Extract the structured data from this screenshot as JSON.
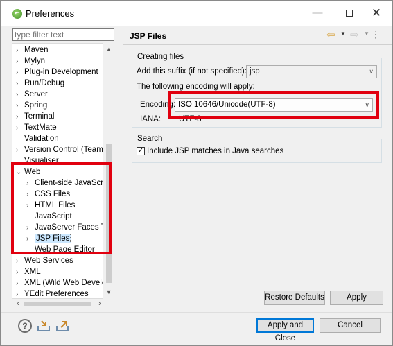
{
  "window": {
    "title": "Preferences",
    "minimize_glyph": "—",
    "close_glyph": "✕"
  },
  "filter": {
    "placeholder": "type filter text"
  },
  "tree": {
    "items": [
      {
        "label": "Maven",
        "arrow": "›"
      },
      {
        "label": "Mylyn",
        "arrow": "›"
      },
      {
        "label": "Plug-in Development",
        "arrow": "›"
      },
      {
        "label": "Run/Debug",
        "arrow": "›"
      },
      {
        "label": "Server",
        "arrow": "›"
      },
      {
        "label": "Spring",
        "arrow": "›"
      },
      {
        "label": "Terminal",
        "arrow": "›"
      },
      {
        "label": "TextMate",
        "arrow": "›"
      },
      {
        "label": "Validation",
        "arrow": ""
      },
      {
        "label": "Version Control (Team)",
        "arrow": "›"
      },
      {
        "label": "Visualiser",
        "arrow": ""
      },
      {
        "label": "Web",
        "arrow": "⌄"
      },
      {
        "label": "Client-side JavaScript",
        "arrow": "›"
      },
      {
        "label": "CSS Files",
        "arrow": "›"
      },
      {
        "label": "HTML Files",
        "arrow": "›"
      },
      {
        "label": "JavaScript",
        "arrow": ""
      },
      {
        "label": "JavaServer Faces Tools",
        "arrow": "›"
      },
      {
        "label": "JSP Files",
        "arrow": "›"
      },
      {
        "label": "Web Page Editor",
        "arrow": ""
      },
      {
        "label": "Web Services",
        "arrow": "›"
      },
      {
        "label": "XML",
        "arrow": "›"
      },
      {
        "label": "XML (Wild Web Developer)",
        "arrow": "›"
      },
      {
        "label": "YEdit Preferences",
        "arrow": "›"
      }
    ],
    "selected": "JSP Files"
  },
  "page": {
    "title": "JSP Files",
    "creating_group": "Creating files",
    "suffix_label": "Add this suffix (if not specified):",
    "suffix_value": "jsp",
    "encoding_note": "The following encoding will apply:",
    "encoding_label": "Encoding:",
    "encoding_value": "ISO 10646/Unicode(UTF-8)",
    "iana_label": "IANA:",
    "iana_value": "UTF-8",
    "search_group": "Search",
    "include_label": "Include JSP matches in Java searches",
    "include_checked": true
  },
  "buttons": {
    "restore_defaults": "Restore Defaults",
    "apply": "Apply",
    "apply_and_close": "Apply and Close",
    "cancel": "Cancel"
  },
  "colors": {
    "highlight": "#e1000f",
    "default_button_border": "#0078d7"
  }
}
